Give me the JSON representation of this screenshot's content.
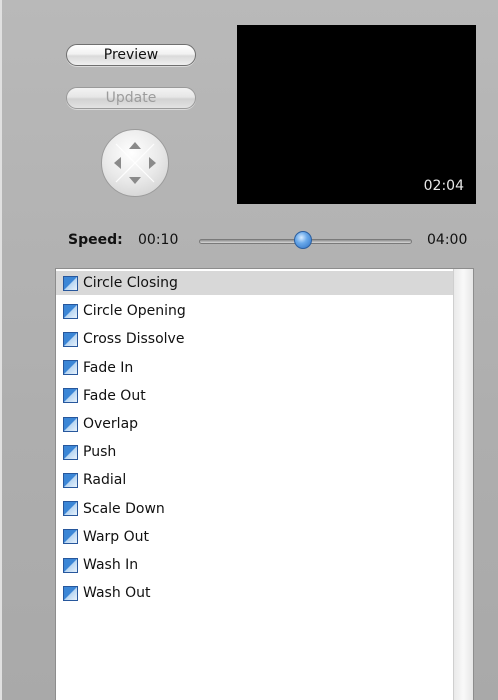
{
  "buttons": {
    "preview_label": "Preview",
    "update_label": "Update"
  },
  "preview": {
    "timecode": "02:04"
  },
  "speed": {
    "label": "Speed:",
    "min": "00:10",
    "max": "04:00",
    "value_fraction": 0.49
  },
  "transitions": {
    "selected_index": 0,
    "items": [
      "Circle Closing",
      "Circle Opening",
      "Cross Dissolve",
      "Fade In",
      "Fade Out",
      "Overlap",
      "Push",
      "Radial",
      "Scale Down",
      "Warp Out",
      "Wash In",
      "Wash Out"
    ]
  },
  "colors": {
    "selection": "#d8d8d8",
    "icon_blue": "#3b86d6",
    "preview_bg": "#000000"
  }
}
